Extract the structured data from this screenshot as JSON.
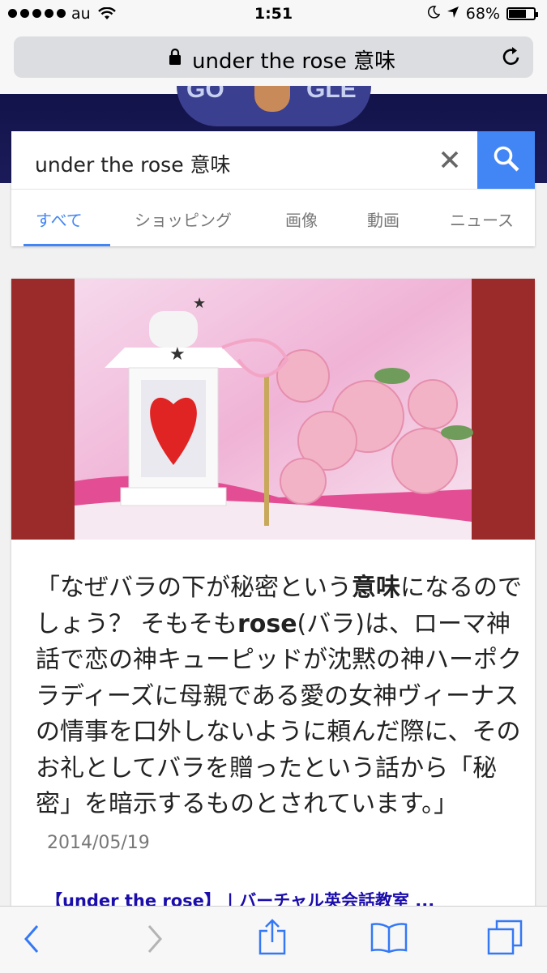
{
  "status_bar": {
    "carrier": "au",
    "time": "1:51",
    "battery": "68%",
    "signal_bars": 5
  },
  "url_bar": {
    "address": "under the rose 意味",
    "icons": [
      "lock-icon",
      "reload-icon"
    ]
  },
  "search": {
    "query": "under the rose 意味",
    "icons": [
      "clear-icon",
      "search-icon"
    ],
    "accent_color": "#4285f4"
  },
  "tabs": [
    {
      "label": "すべて",
      "active": true
    },
    {
      "label": "ショッピング",
      "active": false
    },
    {
      "label": "画像",
      "active": false
    },
    {
      "label": "動画",
      "active": false
    },
    {
      "label": "ニュース",
      "active": false
    }
  ],
  "result": {
    "snippet_parts": {
      "p1": "「なぜバラの下が秘密という",
      "b1": "意味",
      "p2": "になるのでしょう？ そもそも",
      "b2": "rose",
      "p3": "(バラ)は、ローマ神話で恋の神キューピッドが沈黙の神ハーポクラディーズに母親である愛の女神ヴィーナスの情事を口外しないように頼んだ際に、そのお礼としてバラを贈ったという話から「秘密」を暗示するものとされています。」"
    },
    "date": "2014/05/19",
    "link_title": "【under the rose】 | バーチャル英会話教室 ..."
  },
  "toolbar": {
    "icons": [
      "back-icon",
      "forward-icon",
      "share-icon",
      "bookmarks-icon",
      "tabs-icon"
    ]
  }
}
